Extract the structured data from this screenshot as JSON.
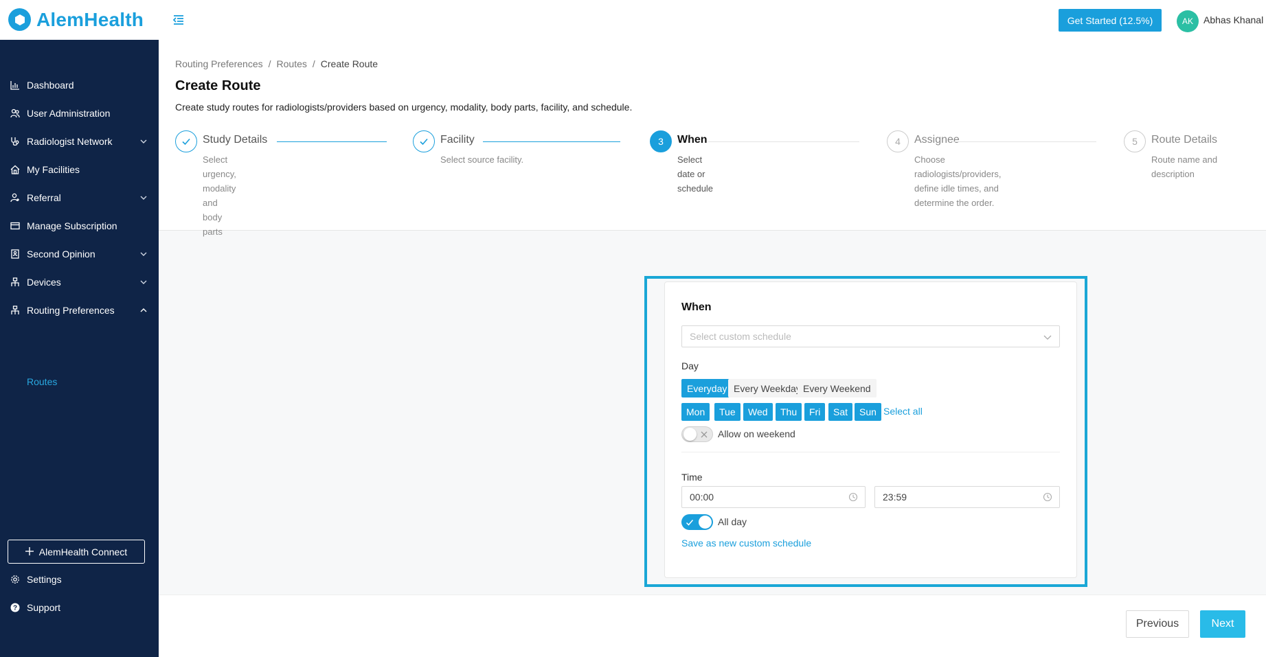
{
  "header": {
    "brand": "AlemHealth",
    "get_started": "Get Started (12.5%)",
    "avatar_initials": "AK",
    "user_name": "Abhas Khanal"
  },
  "sidebar": {
    "items": [
      {
        "label": "Dashboard",
        "icon": "bar-chart-icon"
      },
      {
        "label": "User Administration",
        "icon": "users-icon"
      },
      {
        "label": "Radiologist Network",
        "icon": "stethoscope-icon",
        "expandable": true
      },
      {
        "label": "My Facilities",
        "icon": "home-icon"
      },
      {
        "label": "Referral",
        "icon": "user-referral-icon",
        "expandable": true
      },
      {
        "label": "Manage Subscription",
        "icon": "card-icon"
      },
      {
        "label": "Second Opinion",
        "icon": "clipboard-icon",
        "expandable": true
      },
      {
        "label": "Devices",
        "icon": "network-icon",
        "expandable": true
      },
      {
        "label": "Routing Preferences",
        "icon": "network-icon",
        "expanded": true
      }
    ],
    "sub_items": [
      {
        "label": "Routes"
      }
    ],
    "connect_button": "AlemHealth Connect",
    "settings": "Settings",
    "support": "Support"
  },
  "breadcrumb": [
    "Routing Preferences",
    "Routes",
    "Create Route"
  ],
  "page": {
    "title": "Create Route",
    "description": "Create study routes for radiologists/providers based on urgency, modality, body parts, facility, and schedule."
  },
  "steps": [
    {
      "title": "Study Details",
      "desc": [
        "Select urgency,",
        "modality and body",
        "parts"
      ],
      "status": "done"
    },
    {
      "title": "Facility",
      "desc": [
        "Select source facility."
      ],
      "status": "done"
    },
    {
      "number": "3",
      "title": "When",
      "desc": [
        "Select date or",
        "schedule"
      ],
      "status": "active"
    },
    {
      "number": "4",
      "title": "Assignee",
      "desc": [
        "Choose",
        "radiologists/providers,",
        "define idle times, and",
        "determine the order."
      ],
      "status": "wait"
    },
    {
      "number": "5",
      "title": "Route Details",
      "desc": [
        "Route name and",
        "description"
      ],
      "status": "wait"
    }
  ],
  "form": {
    "title": "When",
    "schedule_placeholder": "Select custom schedule",
    "day_label": "Day",
    "day_presets": [
      "Everyday",
      "Every Weekday",
      "Every Weekend"
    ],
    "selected_preset": "Everyday",
    "days": [
      "Mon",
      "Tue",
      "Wed",
      "Thu",
      "Fri",
      "Sat",
      "Sun"
    ],
    "select_all": "Select all",
    "allow_weekend_label": "Allow on weekend",
    "allow_weekend": false,
    "time_label": "Time",
    "start_time": "00:00",
    "end_time": "23:59",
    "all_day_label": "All day",
    "all_day": true,
    "save_custom": "Save as new custom schedule"
  },
  "footer": {
    "previous": "Previous",
    "next": "Next"
  },
  "colors": {
    "primary": "#1a9fdc",
    "sidebar_bg": "#0f2447",
    "highlight_outline": "#1aa7d6",
    "next_button": "#29bbe8"
  }
}
